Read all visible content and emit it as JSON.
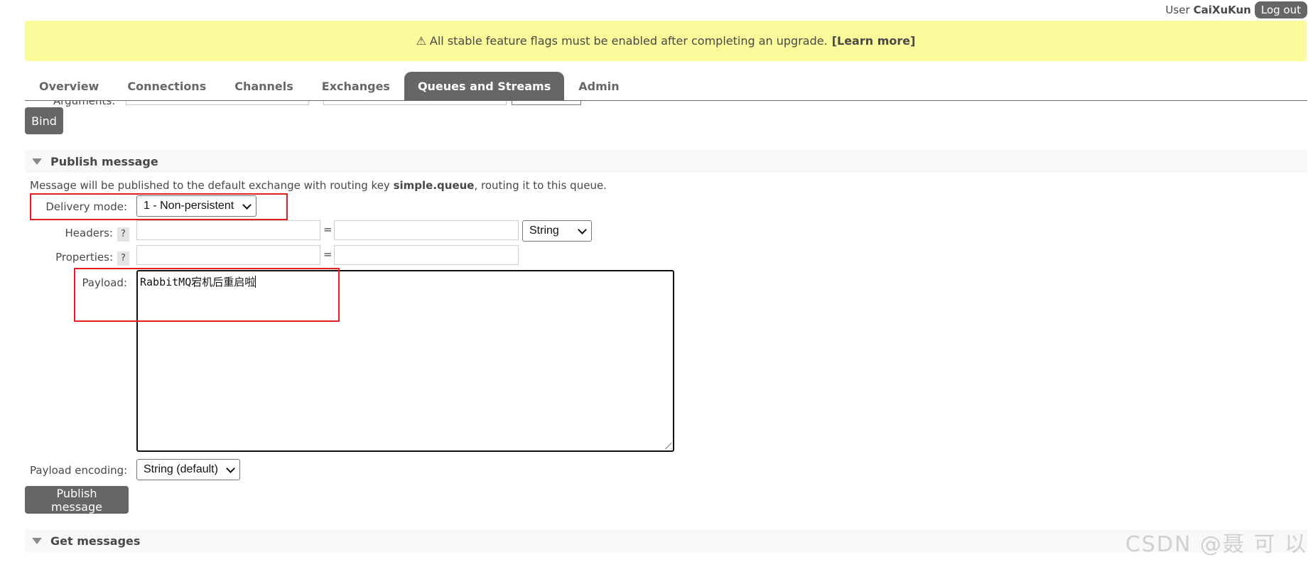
{
  "header": {
    "user_prefix": "User",
    "user_name": "CaiXuKun",
    "logout_label": "Log out"
  },
  "banner": {
    "warning_symbol": "⚠",
    "message": "All stable feature flags must be enabled after completing an upgrade.",
    "link_label": "[Learn more]"
  },
  "tabs": [
    {
      "label": "Overview",
      "active": false
    },
    {
      "label": "Connections",
      "active": false
    },
    {
      "label": "Channels",
      "active": false
    },
    {
      "label": "Exchanges",
      "active": false
    },
    {
      "label": "Queues and Streams",
      "active": true
    },
    {
      "label": "Admin",
      "active": false
    }
  ],
  "bind": {
    "arguments_label": "Arguments:",
    "button_label": "Bind"
  },
  "publish": {
    "section_title": "Publish message",
    "desc_prefix": "Message will be published to the default exchange with routing key ",
    "routing_key": "simple.queue",
    "desc_suffix": ", routing it to this queue.",
    "delivery_mode_label": "Delivery mode:",
    "delivery_mode_value": "1 - Non-persistent",
    "headers_label": "Headers:",
    "help_glyph": "?",
    "equals_sign": "=",
    "headers_type_value": "String",
    "properties_label": "Properties:",
    "payload_label": "Payload:",
    "payload_value": "RabbitMQ宕机后重启啦",
    "encoding_label": "Payload encoding:",
    "encoding_value": "String (default)",
    "button_label": "Publish message"
  },
  "get_messages": {
    "section_title": "Get messages"
  },
  "watermark": "CSDN @聂 可 以",
  "colors": {
    "banner_bg": "#fbfb9c",
    "active_tab_bg": "#666666",
    "button_bg": "#666666",
    "logout_bg": "#666666",
    "annotation_red": "#e02020"
  }
}
